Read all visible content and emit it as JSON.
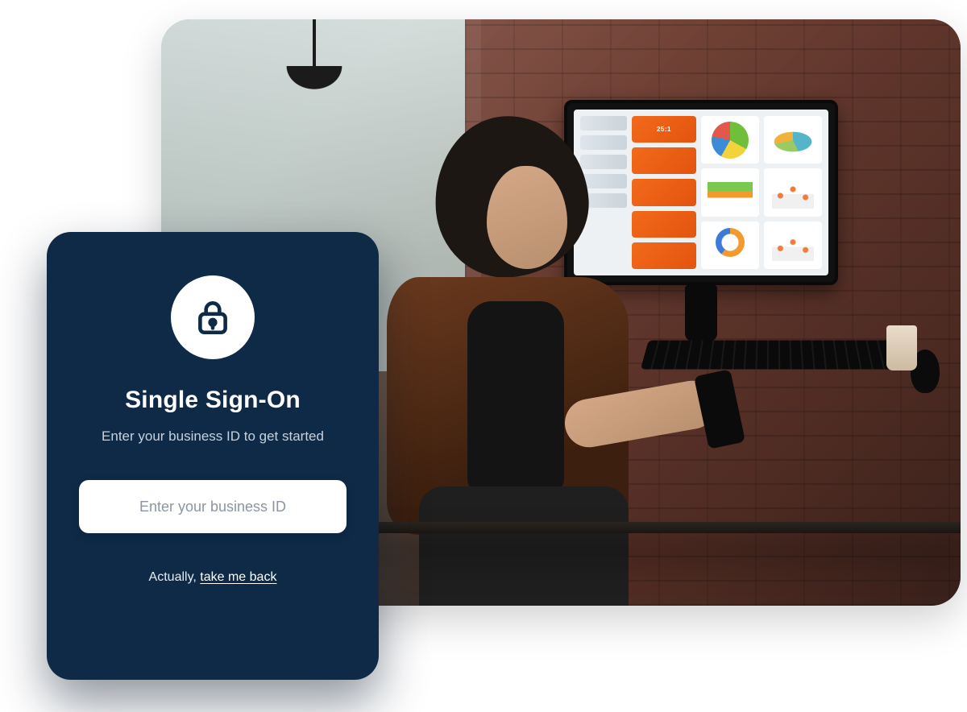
{
  "photo": {
    "monitor_big_number": "25:1"
  },
  "login": {
    "icon_name": "lock-icon",
    "title": "Single Sign-On",
    "subtitle": "Enter your business ID to get started",
    "input_placeholder": "Enter your business ID",
    "input_value": "",
    "back_prefix": "Actually, ",
    "back_link_label": "take me back"
  },
  "colors": {
    "card_bg": "#0e2a47",
    "accent_orange": "#f26a1b"
  }
}
